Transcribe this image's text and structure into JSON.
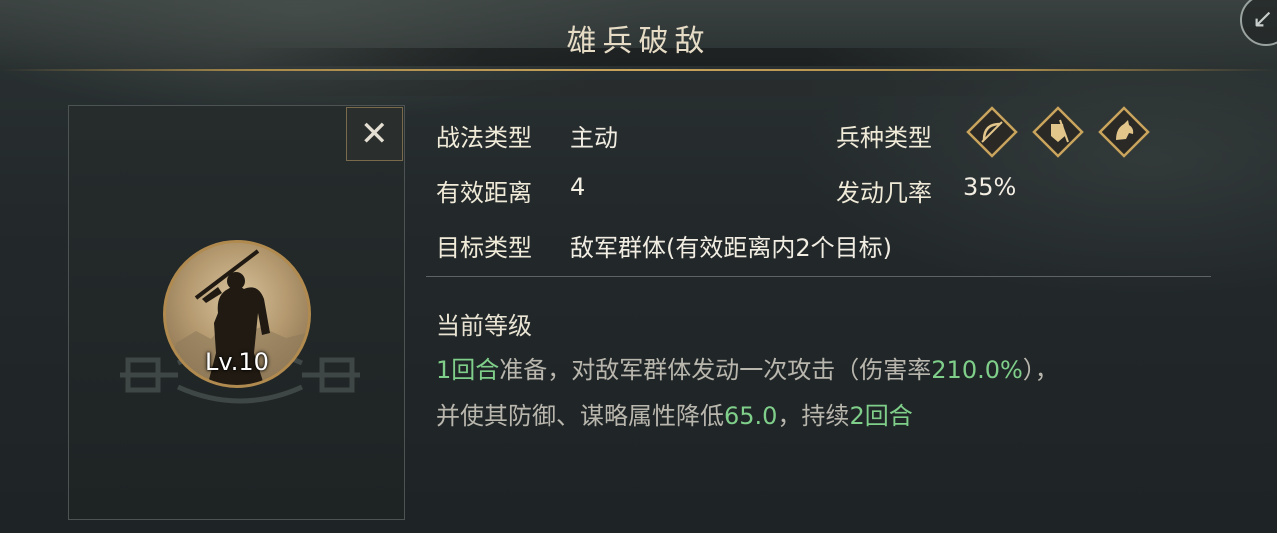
{
  "title": "雄兵破敌",
  "close_label": "✕",
  "skill": {
    "level": "Lv.10",
    "portrait_icon": "spearman-silhouette-icon",
    "tactic_type_label": "战法类型",
    "tactic_type_value": "主动",
    "troop_type_label": "兵种类型",
    "troop_types": [
      "archer-icon",
      "infantry-shield-icon",
      "cavalry-horse-icon"
    ],
    "range_label": "有效距离",
    "range_value": "4",
    "trigger_rate_label": "发动几率",
    "trigger_rate_value": "35%",
    "target_label": "目标类型",
    "target_value": "敌军群体(有效距离内2个目标)"
  },
  "current_level": {
    "title": "当前等级",
    "line1": {
      "p1": "1回合",
      "p2": "准备，对敌军群体发动一次攻击（伤害率",
      "p3": "210.0%",
      "p4": "），"
    },
    "line2": {
      "p1": "并使其防御、谋略属性降低",
      "p2": "65.0",
      "p3": "，持续",
      "p4": "2回合"
    }
  },
  "colors": {
    "highlight": "#7fcf8a",
    "gold": "#c9a45c"
  }
}
